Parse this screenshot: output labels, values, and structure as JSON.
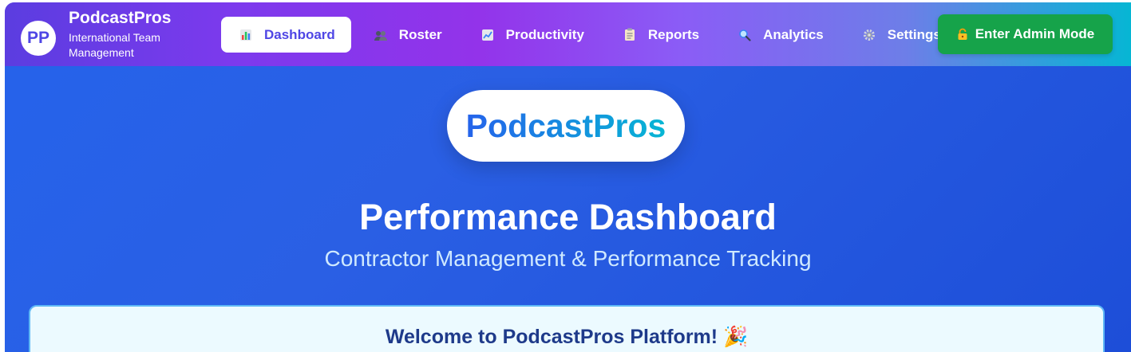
{
  "brand": {
    "logo_initials": "PP",
    "name": "PodcastPros",
    "subtitle": "International Team Management"
  },
  "nav": {
    "items": [
      {
        "label": "Dashboard",
        "icon": "bar-chart-icon",
        "active": true
      },
      {
        "label": "Roster",
        "icon": "people-icon",
        "active": false
      },
      {
        "label": "Productivity",
        "icon": "trend-chart-icon",
        "active": false
      },
      {
        "label": "Reports",
        "icon": "clipboard-icon",
        "active": false
      },
      {
        "label": "Analytics",
        "icon": "magnifier-icon",
        "active": false
      },
      {
        "label": "Settings",
        "icon": "gear-icon",
        "active": false
      }
    ],
    "admin_button": {
      "label": "Enter Admin Mode",
      "icon": "lock-icon"
    }
  },
  "hero": {
    "logo_text": "PodcastPros",
    "title": "Performance Dashboard",
    "subtitle": "Contractor Management & Performance Tracking"
  },
  "welcome": {
    "title": "Welcome to PodcastPros Platform! 🎉"
  },
  "colors": {
    "nav_gradient_start": "#5b3de0",
    "nav_gradient_end": "#06b6d4",
    "hero_bg": "#2563eb",
    "admin_button": "#16a34a",
    "active_text": "#4f46e5"
  }
}
